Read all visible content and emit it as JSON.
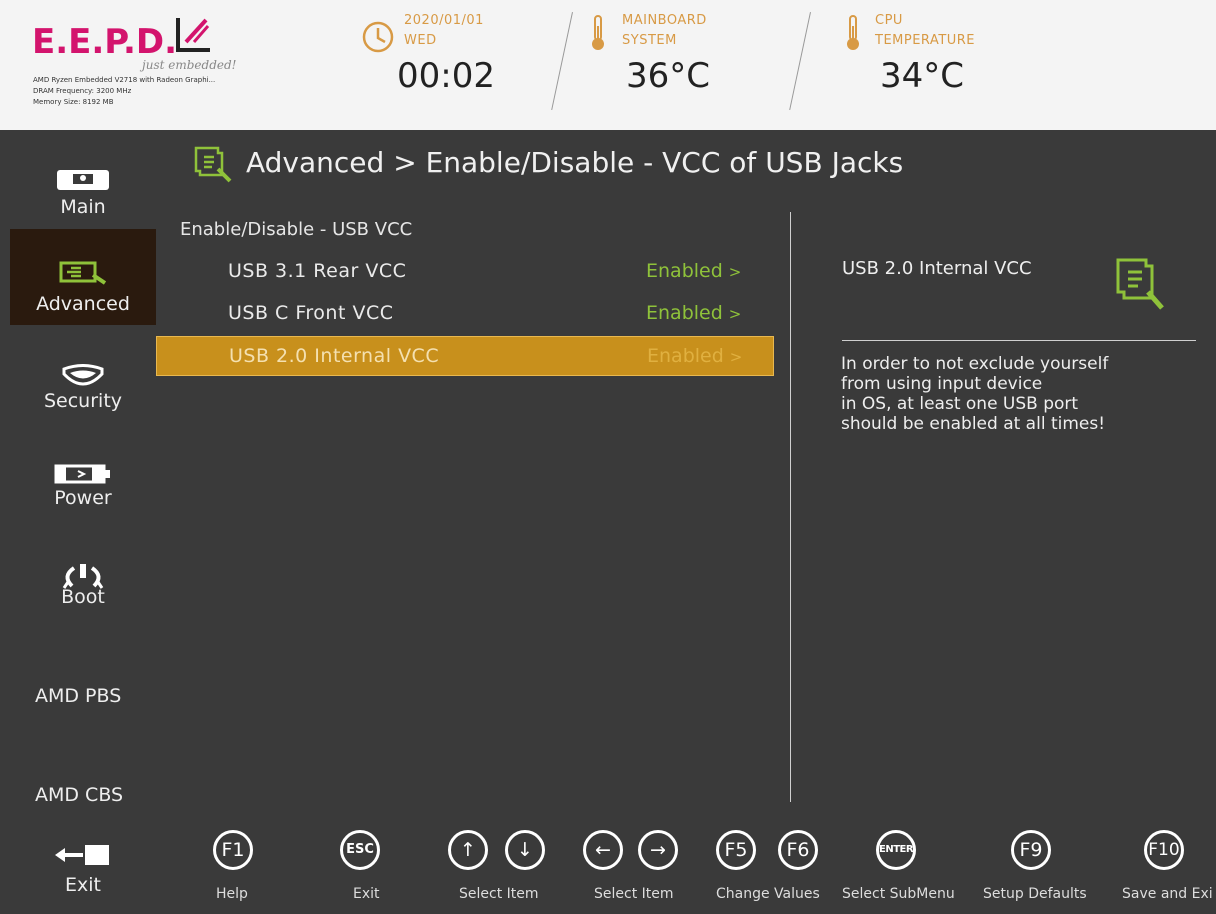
{
  "header": {
    "logo": "E.E.P.D.",
    "tagline": "just embedded!",
    "sysinfo": [
      "AMD Ryzen Embedded V2718 with Radeon Graphi...",
      "DRAM Frequency: 3200 MHz",
      "Memory Size: 8192 MB"
    ],
    "date": "2020/01/01",
    "day": "WED",
    "time": "00:02",
    "mainboard_label1": "MAINBOARD",
    "mainboard_label2": "SYSTEM",
    "mainboard_temp": "36°C",
    "cpu_label1": "CPU",
    "cpu_label2": "TEMPERATURE",
    "cpu_temp": "34°C"
  },
  "sidebar": {
    "items": [
      {
        "label": "Main",
        "icon": "monitor-icon"
      },
      {
        "label": "Advanced",
        "icon": "advanced-icon"
      },
      {
        "label": "Security",
        "icon": "shield-icon"
      },
      {
        "label": "Power",
        "icon": "battery-icon"
      },
      {
        "label": "Boot",
        "icon": "power-icon"
      },
      {
        "label": "AMD PBS"
      },
      {
        "label": "AMD CBS"
      },
      {
        "label": "Exit",
        "icon": "exit-icon"
      }
    ],
    "active": "Advanced"
  },
  "main": {
    "breadcrumb": "Advanced > Enable/Disable - VCC of USB Jacks",
    "section_title": "Enable/Disable - USB VCC",
    "rows": [
      {
        "label": "USB 3.1 Rear VCC",
        "value": "Enabled"
      },
      {
        "label": "USB C Front VCC",
        "value": "Enabled"
      },
      {
        "label": "USB 2.0 Internal VCC",
        "value": "Enabled"
      }
    ],
    "arrow": ">",
    "selected_index": 2
  },
  "help": {
    "title": "USB 2.0 Internal VCC",
    "lines": [
      "In order to not exclude yourself",
      "from using input device",
      "in OS, at least one USB port",
      "should be enabled at all times!"
    ]
  },
  "footer": {
    "keys": [
      {
        "caps": [
          "F1"
        ],
        "label": "Help"
      },
      {
        "caps": [
          "ESC"
        ],
        "label": "Exit"
      },
      {
        "caps": [
          "↑",
          "↓"
        ],
        "label": "Select Item"
      },
      {
        "caps": [
          "←",
          "→"
        ],
        "label": "Select Item"
      },
      {
        "caps": [
          "F5",
          "F6"
        ],
        "label": "Change Values"
      },
      {
        "caps": [
          "ENTER"
        ],
        "label": "Select SubMenu"
      },
      {
        "caps": [
          "F9"
        ],
        "label": "Setup Defaults"
      },
      {
        "caps": [
          "F10"
        ],
        "label": "Save and Exi"
      }
    ]
  },
  "colors": {
    "accent_green": "#8fc23a",
    "selection": "#c8901c",
    "logo": "#d3146d",
    "header_label": "#d89a45"
  }
}
